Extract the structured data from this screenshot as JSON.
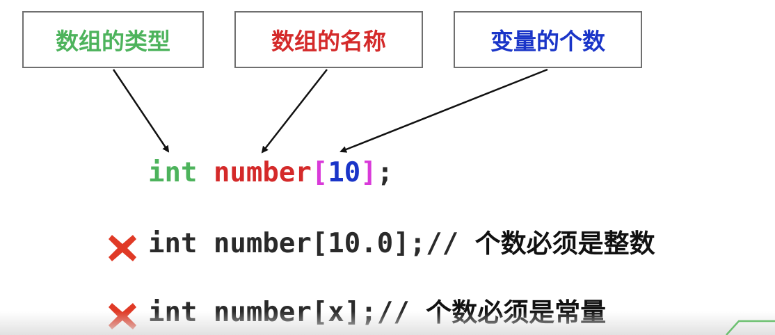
{
  "labels": {
    "type": "数组的类型",
    "name": "数组的名称",
    "count": "变量的个数"
  },
  "code_main": {
    "keyword": "int",
    "identifier": "number",
    "bracket_open": "[",
    "size": "10",
    "bracket_close": "]",
    "terminator": ";"
  },
  "invalid_examples": [
    {
      "code": "int number[10.0];//",
      "note": "个数必须是整数"
    },
    {
      "code": "int number[x];//",
      "note": "个数必须是常量"
    }
  ],
  "colors": {
    "type": "#4db35c",
    "name": "#d42a2a",
    "bracket": "#d93ad9",
    "count": "#1a35c8",
    "error_mark": "#e03a26"
  },
  "icons": [
    "cross-mark-icon"
  ]
}
